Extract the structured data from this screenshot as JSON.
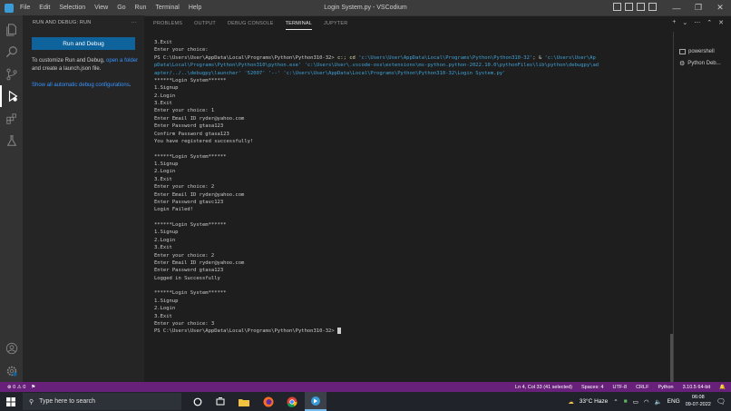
{
  "titlebar": {
    "title": "Login System.py - VSCodium",
    "menu": [
      "File",
      "Edit",
      "Selection",
      "View",
      "Go",
      "Run",
      "Terminal",
      "Help"
    ]
  },
  "sidebar": {
    "header": "RUN AND DEBUG: RUN",
    "more": "···",
    "run_button": "Run and Debug",
    "customize_text_1": "To customize Run and Debug, ",
    "customize_link": "open a folder",
    "customize_text_2": " and create a launch.json file.",
    "show_link": "Show all automatic debug configurations",
    "show_period": "."
  },
  "panel": {
    "tabs": [
      "PROBLEMS",
      "OUTPUT",
      "DEBUG CONSOLE",
      "TERMINAL",
      "JUPYTER"
    ],
    "actions": [
      "+",
      "⌄",
      "⋯",
      "⌃",
      "✕"
    ],
    "terminal_list": [
      "powershell",
      "Python Deb..."
    ]
  },
  "terminal": {
    "lines_pre": [
      "3.Exit",
      "Enter your choice:"
    ],
    "prompt": "PS C:\\Users\\User\\AppData\\Local\\Programs\\Python\\Python310-32>",
    "cmd_head": " c:; cd ",
    "cmd_path1": "'c:\\Users\\User\\AppData\\Local\\Programs\\Python\\Python310-32'",
    "cmd_mid": "; & ",
    "cmd_line1_tail": "'c:\\Users\\User\\Ap",
    "cmd_line2": "pData\\Local\\Programs\\Python\\Python310\\python.exe' 'c:\\Users\\User\\.vscode-oss\\extensions\\ms-python.python-2022.10.0\\pythonFiles\\lib\\python\\debugpy\\ad",
    "cmd_line3": "apter/../..\\debugpy\\launcher' '52007' '--' 'c:\\Users\\User\\AppData\\Local\\Programs\\Python\\Python310-32\\Login System.py'",
    "output": [
      "******Login System******",
      "1.Signup",
      "2.Login",
      "3.Exit",
      "Enter your choice: 1",
      "Enter Email ID ryder@yahoo.com",
      "Enter Password gtasa123",
      "Confirm Password gtasa123",
      "You have registered successfully!",
      "",
      "******Login System******",
      "1.Signup",
      "2.Login",
      "3.Exit",
      "Enter your choice: 2",
      "Enter Email ID ryder@yahoo.com",
      "Enter Password gtavc123",
      "Login Failed!",
      "",
      "******Login System******",
      "1.Signup",
      "2.Login",
      "3.Exit",
      "Enter your choice: 2",
      "Enter Email ID ryder@yahoo.com",
      "Enter Password gtasa123",
      "Logged in Successfully",
      "",
      "******Login System******",
      "1.Signup",
      "2.Login",
      "3.Exit",
      "Enter your choice: 3"
    ],
    "final_prompt": "PS C:\\Users\\User\\AppData\\Local\\Programs\\Python\\Python310-32> "
  },
  "statusbar": {
    "errors": "0",
    "warnings": "0",
    "position": "Ln 4, Col 33 (41 selected)",
    "spaces": "Spaces: 4",
    "encoding": "UTF-8",
    "eol": "CRLF",
    "language": "Python",
    "interpreter": "3.10.5 64-bit"
  },
  "taskbar": {
    "search_placeholder": "Type here to search",
    "weather": "33°C  Haze",
    "lang": "ENG",
    "time": "06:08",
    "date": "09-07-2022"
  },
  "colors": {
    "statusbar": "#68217a",
    "run_button": "#0e639c",
    "link": "#3794ff"
  }
}
